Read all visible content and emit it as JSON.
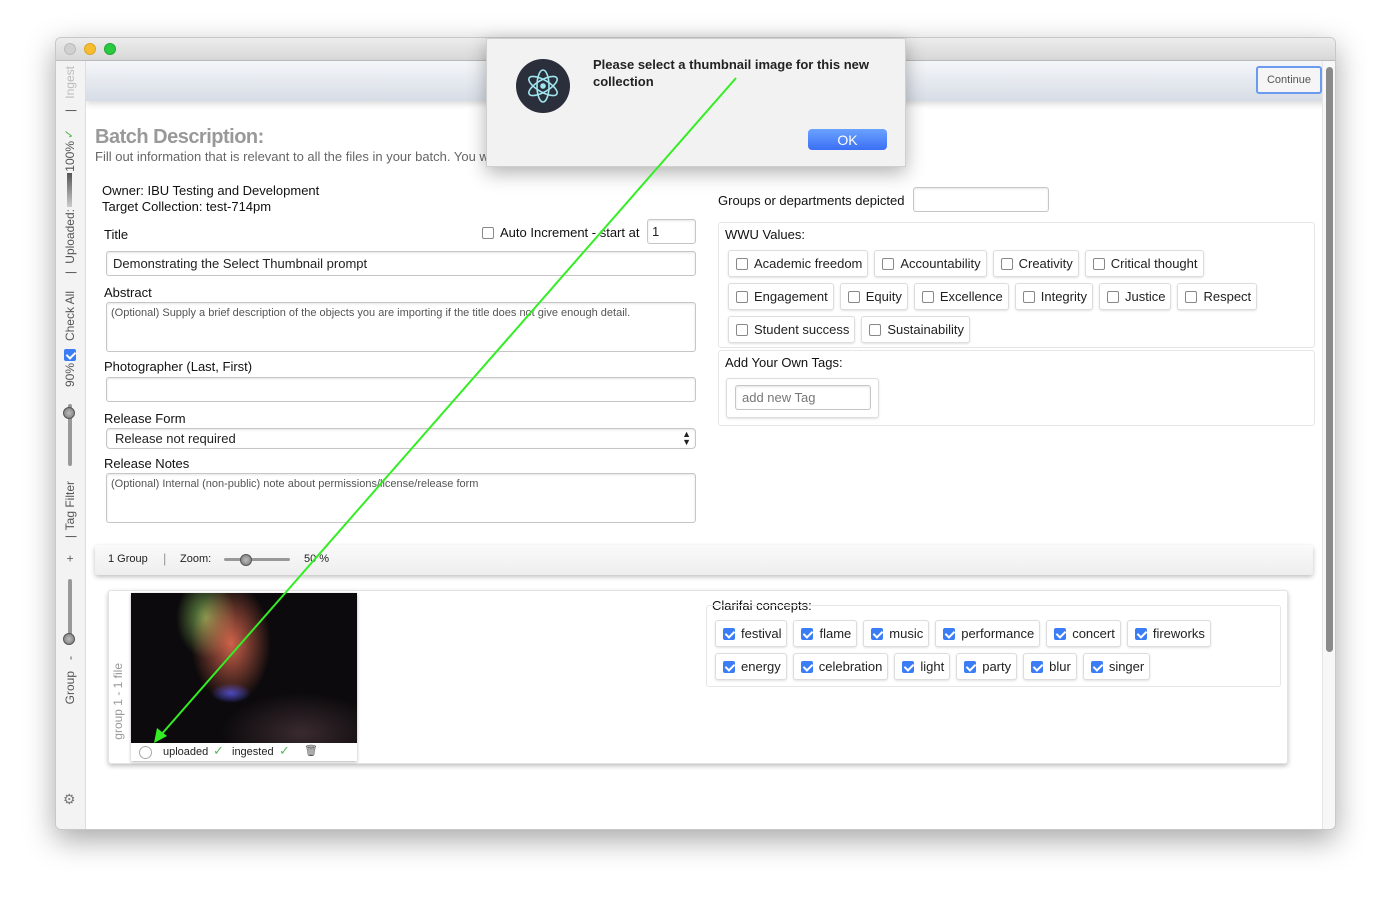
{
  "sidebar": {
    "ingest": "Ingest",
    "uploaded": "Uploaded:",
    "uploaded_pct": "100%",
    "check_all": "Check All",
    "check_pct": "90%",
    "tag_filter": "Tag Filter",
    "group": "Group",
    "minus": "-",
    "plus": "+",
    "sep": "|"
  },
  "header": {
    "continue": "Continue"
  },
  "batch": {
    "title": "Batch Description:",
    "subtitle": "Fill out information that is relevant to all the files in your batch. You w",
    "owner": "Owner: IBU Testing and Development",
    "target": "Target Collection: test-714pm"
  },
  "form": {
    "title_label": "Title",
    "auto_increment": "Auto Increment - start at",
    "start_at": "1",
    "title_value": "Demonstrating the Select Thumbnail prompt",
    "abstract_label": "Abstract",
    "abstract_placeholder": "(Optional) Supply a brief description of the objects you are importing if the title does not give enough detail.",
    "photographer_label": "Photographer (Last, First)",
    "photographer_value": "",
    "release_form_label": "Release Form",
    "release_form_value": "Release not required",
    "release_notes_label": "Release Notes",
    "release_notes_placeholder": "(Optional) Internal (non-public) note about permissions/license/release form"
  },
  "right": {
    "groups_label": "Groups or departments depicted",
    "groups_value": "",
    "wwu_label": "WWU Values:",
    "wwu_values": [
      {
        "label": "Academic freedom",
        "checked": false
      },
      {
        "label": "Accountability",
        "checked": false
      },
      {
        "label": "Creativity",
        "checked": false
      },
      {
        "label": "Critical thought",
        "checked": false
      },
      {
        "label": "Engagement",
        "checked": false
      },
      {
        "label": "Equity",
        "checked": false
      },
      {
        "label": "Excellence",
        "checked": false
      },
      {
        "label": "Integrity",
        "checked": false
      },
      {
        "label": "Justice",
        "checked": false
      },
      {
        "label": "Respect",
        "checked": false
      },
      {
        "label": "Student success",
        "checked": false
      },
      {
        "label": "Sustainability",
        "checked": false
      }
    ],
    "own_tags_label": "Add Your Own Tags:",
    "tag_placeholder": "add new Tag"
  },
  "toolbar": {
    "groups": "1 Group",
    "zoom_label": "Zoom:",
    "zoom_value": "50 %",
    "zoom_fraction": 0.3
  },
  "group": {
    "label": "group 1 - 1 file",
    "uploaded": "uploaded",
    "ingested": "ingested",
    "clarifai_label": "Clarifai concepts:",
    "concepts": [
      {
        "label": "festival",
        "checked": true
      },
      {
        "label": "flame",
        "checked": true
      },
      {
        "label": "music",
        "checked": true
      },
      {
        "label": "performance",
        "checked": true
      },
      {
        "label": "concert",
        "checked": true
      },
      {
        "label": "fireworks",
        "checked": true
      },
      {
        "label": "energy",
        "checked": true
      },
      {
        "label": "celebration",
        "checked": true
      },
      {
        "label": "light",
        "checked": true
      },
      {
        "label": "party",
        "checked": true
      },
      {
        "label": "blur",
        "checked": true
      },
      {
        "label": "singer",
        "checked": true
      }
    ]
  },
  "dialog": {
    "message": "Please select a thumbnail image for this new collection",
    "ok": "OK"
  },
  "colors": {
    "accent": "#3b7df5",
    "annotation_arrow": "#33ee22",
    "check": "#5cb85c"
  }
}
